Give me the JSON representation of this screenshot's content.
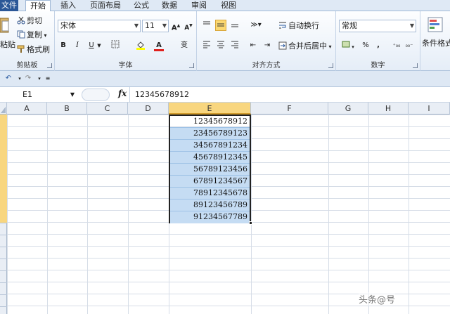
{
  "tabs": {
    "file": "文件",
    "items": [
      "开始",
      "插入",
      "页面布局",
      "公式",
      "数据",
      "审阅",
      "视图"
    ],
    "active": "开始"
  },
  "ribbon": {
    "clipboard": {
      "paste": "粘贴",
      "cut": "剪切",
      "copy": "复制",
      "format_painter": "格式刷",
      "title": "剪贴板"
    },
    "font": {
      "name": "宋体",
      "size": "11",
      "bold": "B",
      "italic": "I",
      "underline": "U",
      "wen": "变",
      "title": "字体"
    },
    "alignment": {
      "wrap_text": "自动换行",
      "merge_center": "合并后居中",
      "title": "对齐方式"
    },
    "number": {
      "format": "常规",
      "percent": "%",
      "comma": ",",
      "title": "数字"
    },
    "styles": {
      "conditional": "条件格式"
    }
  },
  "formula_bar": {
    "name_box": "E1",
    "fx": "fx",
    "value": "12345678912"
  },
  "columns": [
    "A",
    "B",
    "C",
    "D",
    "E",
    "F",
    "G",
    "H",
    "I"
  ],
  "cells_E": [
    "12345678912",
    "23456789123",
    "34567891234",
    "45678912345",
    "56789123456",
    "67891234567",
    "78912345678",
    "89123456789",
    "91234567789"
  ],
  "watermark": "头条@号",
  "colors": {
    "selected_header": "#f8d67f",
    "highlight": "#c5dcf3",
    "file_tab": "#2b5797"
  }
}
